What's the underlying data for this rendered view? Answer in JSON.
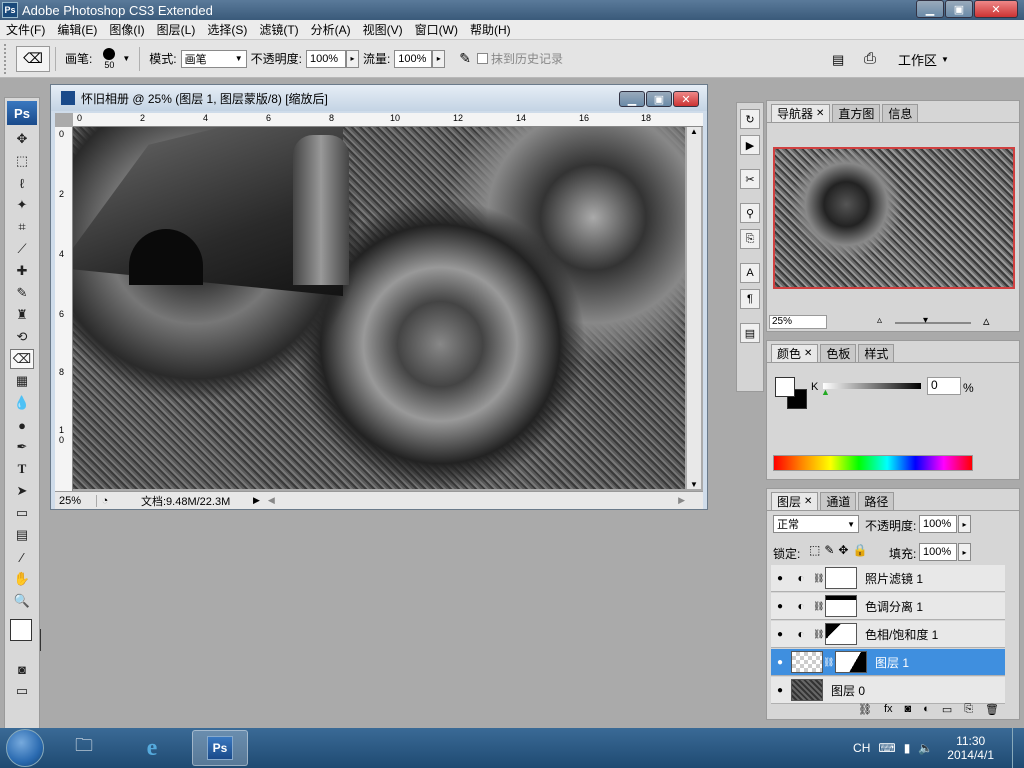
{
  "window": {
    "title": "Adobe Photoshop CS3 Extended",
    "logo": "Ps",
    "min": "▁",
    "max": "▣",
    "close": "✕"
  },
  "menu": [
    "文件(F)",
    "编辑(E)",
    "图像(I)",
    "图层(L)",
    "选择(S)",
    "滤镜(T)",
    "分析(A)",
    "视图(V)",
    "窗口(W)",
    "帮助(H)"
  ],
  "options": {
    "brush_label": "画笔:",
    "brush_size": "50",
    "mode_label": "模式:",
    "mode_value": "画笔",
    "opacity_label": "不透明度:",
    "opacity_value": "100%",
    "flow_label": "流量:",
    "flow_value": "100%",
    "history_label": "抹到历史记录",
    "workspace_label": "工作区"
  },
  "toolbox": {
    "logo": "Ps"
  },
  "document": {
    "title": "怀旧相册 @ 25% (图层 1, 图层蒙版/8) [缩放后]",
    "zoom": "25%",
    "doc_info": "文档:9.48M/22.3M",
    "ruler_top": [
      "0",
      "2",
      "4",
      "6",
      "8",
      "10",
      "12",
      "14",
      "16",
      "18"
    ],
    "ruler_left": [
      "0",
      "2",
      "4",
      "6",
      "8",
      "1\n0"
    ]
  },
  "navigator": {
    "tabs": [
      "导航器",
      "直方图",
      "信息"
    ],
    "zoom": "25%"
  },
  "color": {
    "tabs": [
      "颜色",
      "色板",
      "样式"
    ],
    "channel": "K",
    "value": "0",
    "unit": "%"
  },
  "layers": {
    "tabs": [
      "图层",
      "通道",
      "路径"
    ],
    "blend_mode": "正常",
    "opacity_label": "不透明度:",
    "opacity_value": "100%",
    "lock_label": "锁定:",
    "fill_label": "填充:",
    "fill_value": "100%",
    "rows": [
      {
        "name": "照片滤镜 1"
      },
      {
        "name": "色调分离 1"
      },
      {
        "name": "色相/饱和度 1"
      },
      {
        "name": "图层 1"
      },
      {
        "name": "图层 0"
      }
    ]
  },
  "taskbar": {
    "lang": "CH",
    "time": "11:30",
    "date": "2014/4/1",
    "ps_label": "Ps"
  }
}
